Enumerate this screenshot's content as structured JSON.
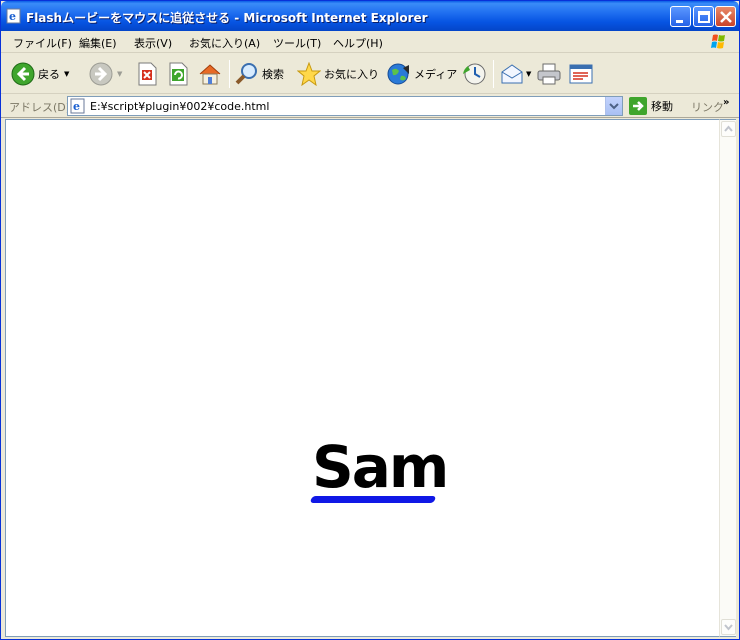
{
  "window": {
    "title": "Flashムービーをマウスに追従させる - Microsoft Internet Explorer"
  },
  "menu": {
    "items": [
      "ファイル(F)",
      "編集(E)",
      "表示(V)",
      "お気に入り(A)",
      "ツール(T)",
      "ヘルプ(H)"
    ]
  },
  "toolbar": {
    "back_label": "戻る",
    "search_label": "検索",
    "favorites_label": "お気に入り",
    "media_label": "メディア"
  },
  "address": {
    "label": "アドレス(D)",
    "url": "E:¥script¥plugin¥002¥code.html",
    "go_label": "移動",
    "links_label": "リンク"
  },
  "content": {
    "flash_text": "Sam"
  },
  "colors": {
    "titlebar": "#0654e2",
    "flash_underline": "#1018e6"
  }
}
